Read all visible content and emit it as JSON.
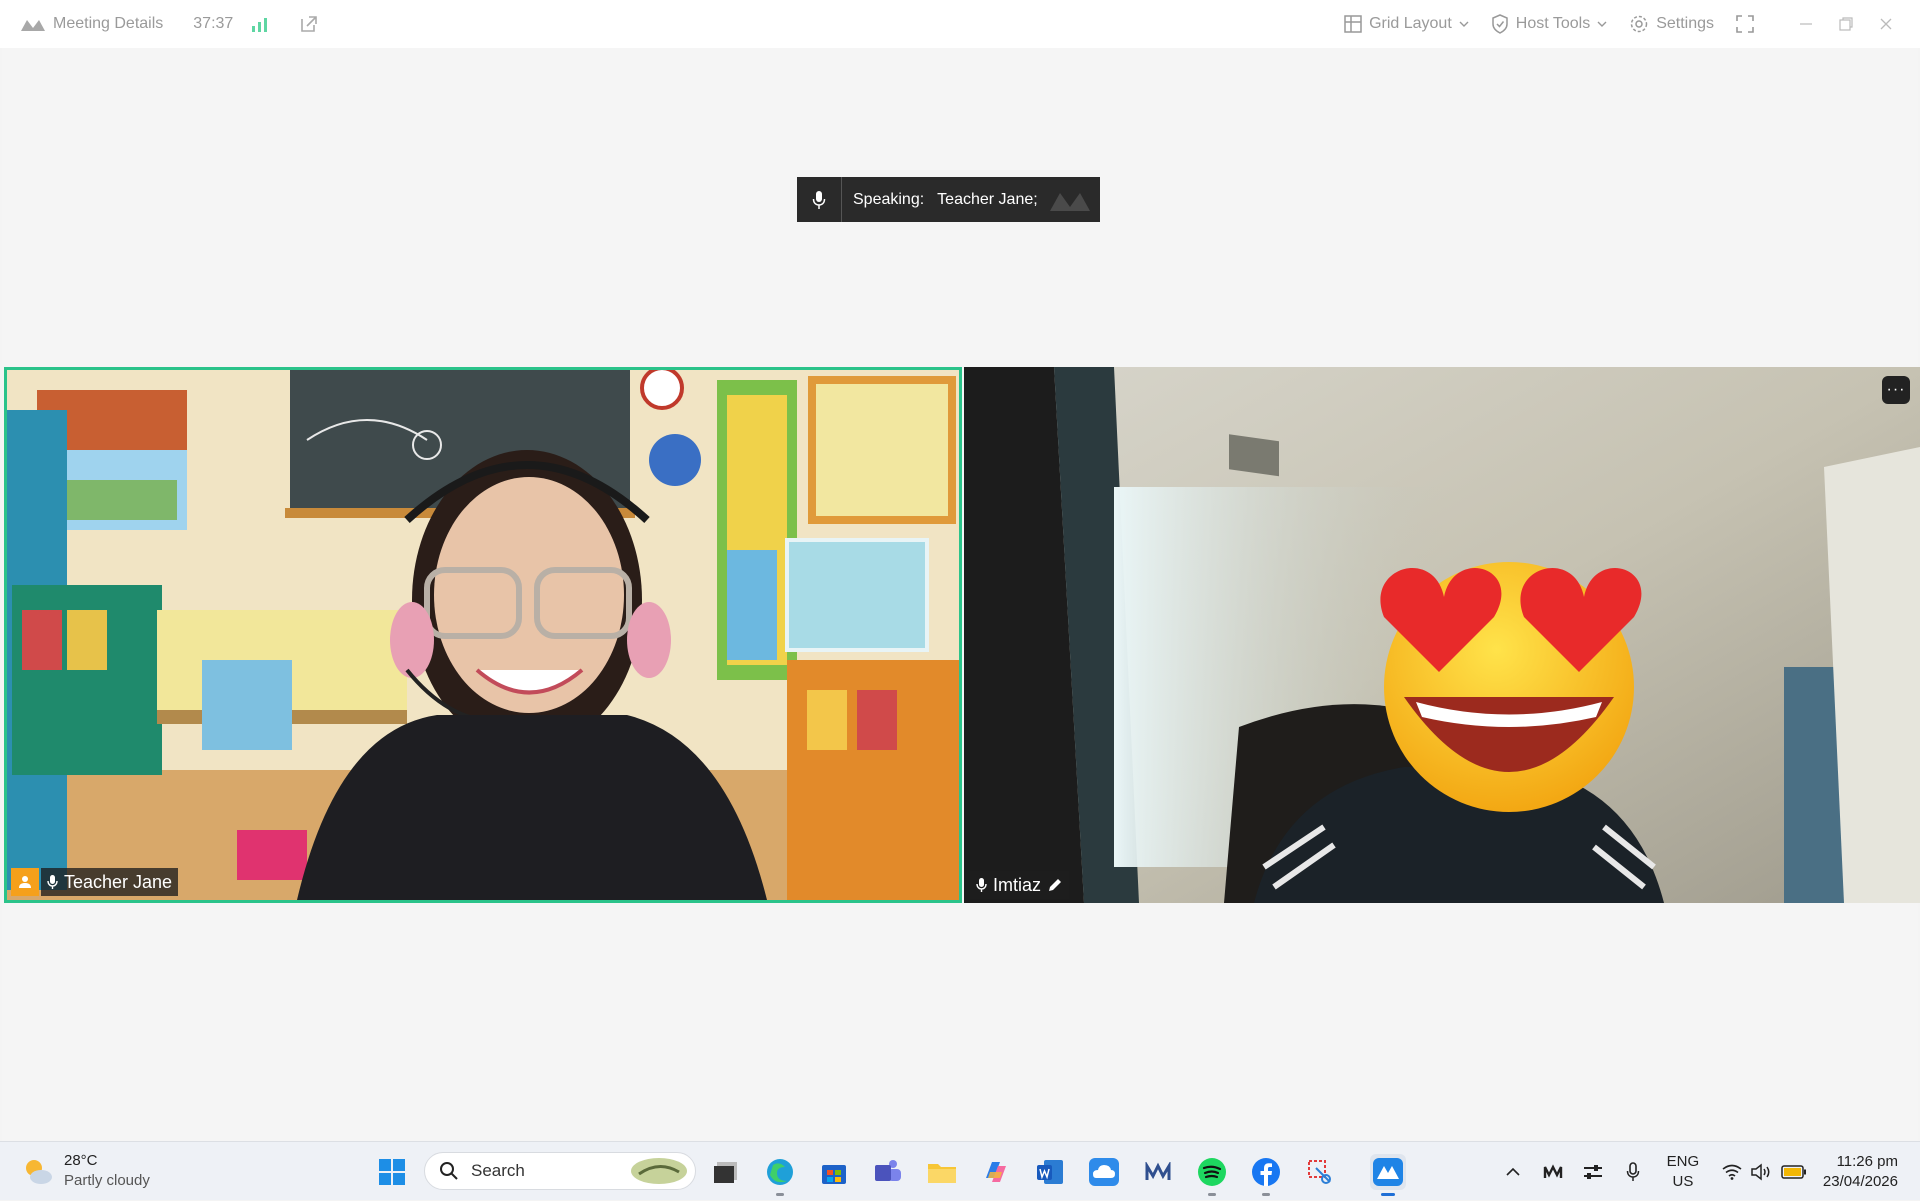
{
  "titlebar": {
    "meeting_details_label": "Meeting Details",
    "timer": "37:37",
    "grid_layout_label": "Grid Layout",
    "host_tools_label": "Host Tools",
    "settings_label": "Settings"
  },
  "speaking": {
    "label": "Speaking:",
    "name": "Teacher Jane;"
  },
  "participants": [
    {
      "name": "Teacher Jane",
      "active_speaker": true
    },
    {
      "name": "Imtiaz",
      "active_speaker": false
    }
  ],
  "taskbar": {
    "weather": {
      "temp": "28°C",
      "condition": "Partly cloudy"
    },
    "search_placeholder": "Search",
    "apps": [
      "start",
      "file-stack",
      "edge",
      "store",
      "teams",
      "file-explorer",
      "copilot",
      "word",
      "onedrive",
      "meeting-app",
      "spotify",
      "facebook",
      "snipping-tool",
      "video-meeting"
    ],
    "lang_top": "ENG",
    "lang_bottom": "US",
    "time": "11:26 pm",
    "date": "23/04/2026"
  },
  "colors": {
    "active_border": "#2bc38a",
    "accent": "#1f6fd6",
    "badge": "#f5a01b"
  }
}
